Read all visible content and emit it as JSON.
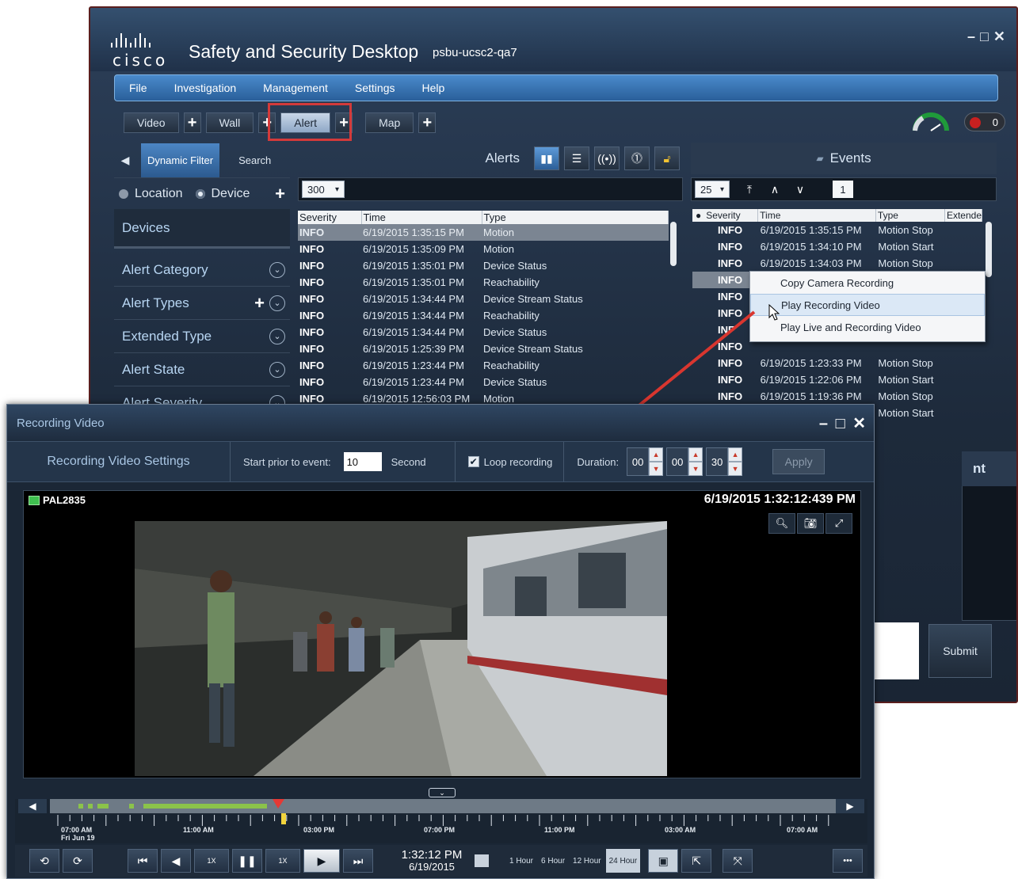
{
  "app": {
    "brand": "cisco",
    "title": "Safety and Security Desktop",
    "host": "psbu-ucsc2-qa7",
    "window_controls": [
      "–",
      "□",
      "✕"
    ]
  },
  "menu": [
    "File",
    "Investigation",
    "Management",
    "Settings",
    "Help"
  ],
  "tabs": [
    {
      "label": "Video",
      "active": false
    },
    {
      "label": "Wall",
      "active": false
    },
    {
      "label": "Alert",
      "active": true
    },
    {
      "label": "Map",
      "active": false
    }
  ],
  "alarm_count": "0",
  "filter": {
    "tabs": [
      "Dynamic Filter",
      "Search"
    ],
    "radio_location": "Location",
    "radio_device": "Device",
    "devices": "Devices",
    "items": [
      "Alert Category",
      "Alert Types",
      "Extended Type",
      "Alert State",
      "Alert Severity"
    ]
  },
  "alerts": {
    "title": "Alerts",
    "page_size": "300",
    "columns": [
      "Severity",
      "Time",
      "Type"
    ],
    "rows": [
      [
        "INFO",
        "6/19/2015 1:35:15 PM",
        "Motion"
      ],
      [
        "INFO",
        "6/19/2015 1:35:09 PM",
        "Motion"
      ],
      [
        "INFO",
        "6/19/2015 1:35:01 PM",
        "Device Status"
      ],
      [
        "INFO",
        "6/19/2015 1:35:01 PM",
        "Reachability"
      ],
      [
        "INFO",
        "6/19/2015 1:34:44 PM",
        "Device Stream Status"
      ],
      [
        "INFO",
        "6/19/2015 1:34:44 PM",
        "Reachability"
      ],
      [
        "INFO",
        "6/19/2015 1:34:44 PM",
        "Device Status"
      ],
      [
        "INFO",
        "6/19/2015 1:25:39 PM",
        "Device Stream Status"
      ],
      [
        "INFO",
        "6/19/2015 1:23:44 PM",
        "Reachability"
      ],
      [
        "INFO",
        "6/19/2015 1:23:44 PM",
        "Device Status"
      ],
      [
        "INFO",
        "6/19/2015 12:56:03 PM",
        "Motion"
      ]
    ]
  },
  "events": {
    "title": "Events",
    "page_size": "25",
    "page": "1",
    "columns": [
      "Severity",
      "Time",
      "Type",
      "Extende"
    ],
    "rows": [
      [
        "INFO",
        "6/19/2015 1:35:15 PM",
        "Motion Stop"
      ],
      [
        "INFO",
        "6/19/2015 1:34:10 PM",
        "Motion Start"
      ],
      [
        "INFO",
        "6/19/2015 1:34:03 PM",
        "Motion Stop"
      ],
      [
        "INFO",
        "",
        ""
      ],
      [
        "INFO",
        "",
        ""
      ],
      [
        "INFO",
        "",
        ""
      ],
      [
        "INF",
        "",
        ""
      ],
      [
        "INFO",
        "",
        ""
      ],
      [
        "INFO",
        "6/19/2015 1:23:33 PM",
        "Motion Stop"
      ],
      [
        "INFO",
        "6/19/2015 1:22:06 PM",
        "Motion Start"
      ],
      [
        "INFO",
        "6/19/2015 1:19:36 PM",
        "Motion Stop"
      ],
      [
        "INFO",
        "",
        "Motion Start"
      ]
    ],
    "partial_label": "nt"
  },
  "context_menu": [
    "Copy Camera Recording",
    "Play Recording Video",
    "Play Live and Recording Video"
  ],
  "submit_label": "Submit",
  "recording": {
    "window_title": "Recording Video",
    "settings_title": "Recording Video Settings",
    "start_prior_label": "Start prior to event:",
    "start_prior_value": "10",
    "second_label": "Second",
    "loop_label": "Loop recording",
    "loop_checked": true,
    "duration_label": "Duration:",
    "duration": [
      "00",
      "00",
      "30"
    ],
    "apply_label": "Apply",
    "camera_name": "PAL2835",
    "video_timestamp": "6/19/2015 1:32:12:439 PM",
    "timeline_labels": [
      "07:00 AM",
      "Fri Jun 19",
      "11:00 AM",
      "03:00 PM",
      "07:00 PM",
      "11:00 PM",
      "03:00 AM",
      "07:00 AM"
    ],
    "speed_labels": [
      "1X",
      "1X"
    ],
    "clock_time": "1:32:12 PM",
    "clock_date": "6/19/2015",
    "ranges": [
      "1 Hour",
      "6 Hour",
      "12 Hour",
      "24 Hour"
    ],
    "active_range": "24 Hour",
    "more_label": "•••"
  }
}
